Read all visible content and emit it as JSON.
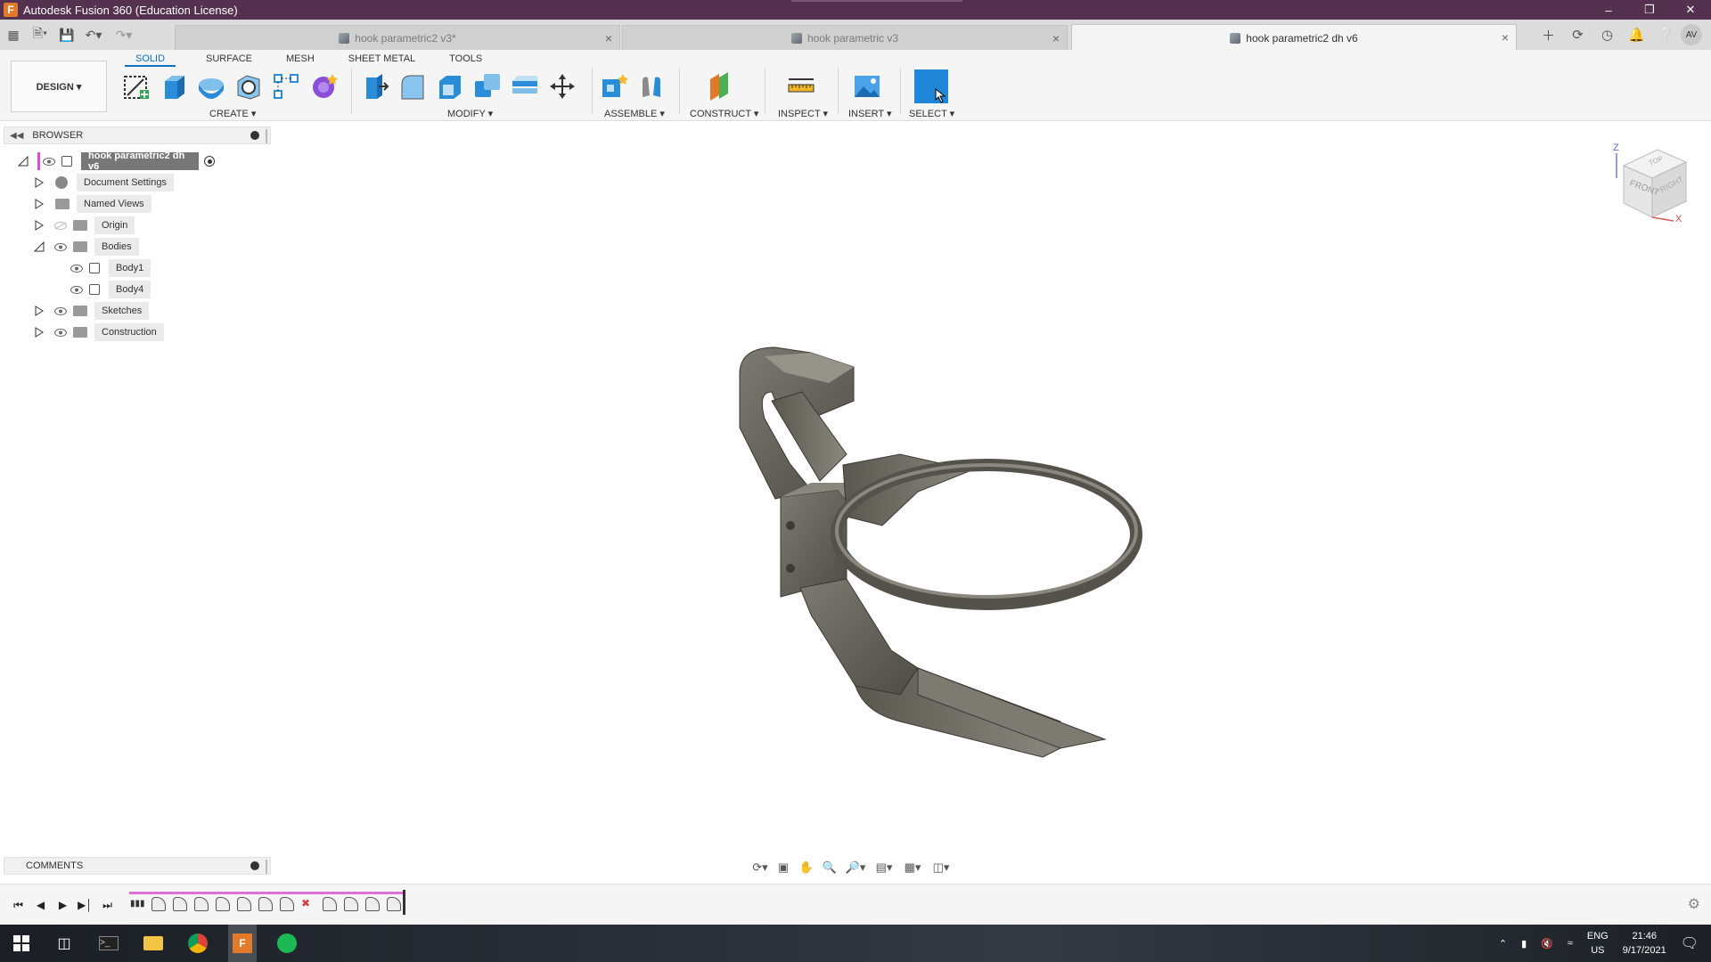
{
  "window": {
    "title": "Autodesk Fusion 360 (Education License)",
    "app_icon": "F"
  },
  "tabs": [
    {
      "label": "hook parametric2 v3*",
      "active": false
    },
    {
      "label": "hook parametric v3",
      "active": false
    },
    {
      "label": "hook parametric2 dh v6",
      "active": true
    }
  ],
  "user": {
    "initials": "AV"
  },
  "workspace_tabs": [
    "SOLID",
    "SURFACE",
    "MESH",
    "SHEET METAL",
    "TOOLS"
  ],
  "design_menu": "DESIGN ▾",
  "groups": {
    "create": "CREATE ▾",
    "modify": "MODIFY ▾",
    "assemble": "ASSEMBLE ▾",
    "construct": "CONSTRUCT ▾",
    "inspect": "INSPECT ▾",
    "insert": "INSERT ▾",
    "select": "SELECT ▾"
  },
  "browser": {
    "title": "BROWSER",
    "root": "hook parametric2 dh v6",
    "items": [
      "Document Settings",
      "Named Views",
      "Origin",
      "Bodies",
      "Body1",
      "Body4",
      "Sketches",
      "Construction"
    ]
  },
  "viewcube": {
    "top": "TOP",
    "front": "FRONT",
    "right": "RIGHT",
    "z": "Z",
    "x": "X"
  },
  "comments": {
    "title": "COMMENTS"
  },
  "taskbar": {
    "lang": "ENG",
    "region": "US",
    "time": "21:46",
    "date": "9/17/2021"
  },
  "colors": {
    "titlebar": "#54314f",
    "accent": "#0b6fc2",
    "timeline": "#e070d8"
  }
}
